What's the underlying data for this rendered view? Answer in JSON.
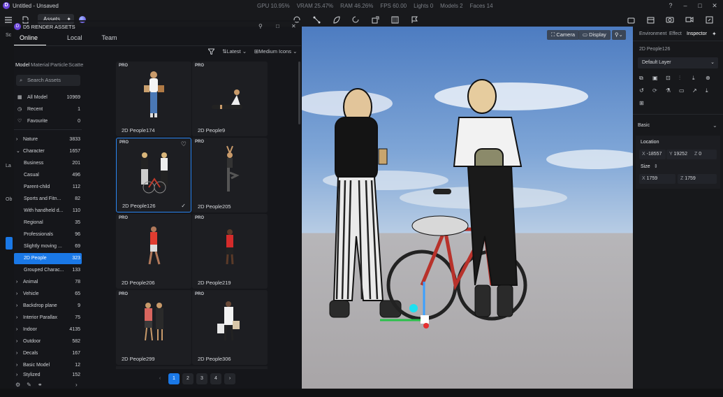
{
  "titlebar": {
    "title": "Untitled - Unsaved",
    "gpu": "GPU 10.95%",
    "vram": "VRAM 25.47%",
    "ram": "RAM 46.26%",
    "fps": "FPS 60.00",
    "lights": "Lights 0",
    "models": "Models 2",
    "faces": "Faces 14"
  },
  "toolbar": {
    "assets_label": "Assets"
  },
  "leftcol": {
    "items": [
      "Sc",
      "La",
      "Ob"
    ]
  },
  "panel": {
    "title": "D5 RENDER ASSETS",
    "tabs": [
      "Online",
      "Local",
      "Team"
    ],
    "sort_label": "Latest",
    "view_label": "Medium Icons",
    "cat_tabs": [
      "Model",
      "Material",
      "Particle",
      "Scatte"
    ],
    "search_placeholder": "Search Assets",
    "top_items": [
      {
        "label": "All Model",
        "count": "10969"
      },
      {
        "label": "Recent",
        "count": "1"
      },
      {
        "label": "Favourite",
        "count": "0"
      }
    ],
    "categories": [
      {
        "label": "Nature",
        "count": "3833",
        "type": "main"
      },
      {
        "label": "Character",
        "count": "1657",
        "type": "main"
      },
      {
        "label": "Business",
        "count": "201",
        "type": "sub"
      },
      {
        "label": "Casual",
        "count": "496",
        "type": "sub"
      },
      {
        "label": "Parent-child",
        "count": "112",
        "type": "sub"
      },
      {
        "label": "Sports and Fitn...",
        "count": "82",
        "type": "sub"
      },
      {
        "label": "With handheld d...",
        "count": "110",
        "type": "sub"
      },
      {
        "label": "Regional",
        "count": "35",
        "type": "sub"
      },
      {
        "label": "Professionals",
        "count": "96",
        "type": "sub"
      },
      {
        "label": "Slightly moving ...",
        "count": "69",
        "type": "sub"
      },
      {
        "label": "2D People",
        "count": "323",
        "type": "sub",
        "active": true
      },
      {
        "label": "Grouped Charac...",
        "count": "133",
        "type": "sub"
      },
      {
        "label": "Animal",
        "count": "78",
        "type": "main"
      },
      {
        "label": "Vehicle",
        "count": "65",
        "type": "main"
      },
      {
        "label": "Backdrop plane",
        "count": "9",
        "type": "main"
      },
      {
        "label": "Interior Parallax",
        "count": "75",
        "type": "main"
      },
      {
        "label": "Indoor",
        "count": "4135",
        "type": "main"
      },
      {
        "label": "Outdoor",
        "count": "582",
        "type": "main"
      },
      {
        "label": "Decals",
        "count": "167",
        "type": "main"
      },
      {
        "label": "Basic Model",
        "count": "12",
        "type": "main"
      },
      {
        "label": "Stylized",
        "count": "152",
        "type": "main"
      }
    ],
    "cards": [
      {
        "badge": "PRO",
        "name": "2D People174"
      },
      {
        "badge": "PRO",
        "name": "2D People9"
      },
      {
        "badge": "PRO",
        "name": "2D People126",
        "selected": true
      },
      {
        "badge": "PRO",
        "name": "2D People205"
      },
      {
        "badge": "PRO",
        "name": "2D People206"
      },
      {
        "badge": "PRO",
        "name": "2D People219"
      },
      {
        "badge": "PRO",
        "name": "2D People299"
      },
      {
        "badge": "PRO",
        "name": "2D People306"
      }
    ],
    "pages": [
      "1",
      "2",
      "3",
      "4"
    ],
    "current_page": "1"
  },
  "viewport": {
    "camera_label": "Camera",
    "display_label": "Display"
  },
  "inspector": {
    "tabs": [
      "Environment",
      "Effect",
      "Inspector"
    ],
    "object_name": "2D People126",
    "layer": "Default Layer",
    "section_basic": "Basic",
    "location_label": "Location",
    "loc_x": "-18557",
    "loc_y": "19252",
    "loc_z": "0",
    "size_label": "Size",
    "size_x": "1759",
    "size_z": "1759"
  },
  "colors": {
    "accent": "#1a78e6",
    "brand": "#6b45d9"
  }
}
